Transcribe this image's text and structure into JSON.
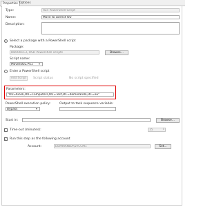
{
  "tabs": {
    "properties": "Properties",
    "options": "Options"
  },
  "type": {
    "label": "Type:",
    "value": "Run PowerShell Script"
  },
  "name": {
    "label": "Name:",
    "value": "Move to correct OU"
  },
  "description": {
    "label": "Description:",
    "value": ""
  },
  "package_option": {
    "label": "Select a package with a PowerShell script"
  },
  "package": {
    "label": "Package:",
    "value": "DB0001C3, OSD Powershell scripts",
    "browse": "Browse..."
  },
  "script_name": {
    "label": "Script name:",
    "value": "MoveToOu.PS1"
  },
  "enter_option": {
    "label": "Enter a PowerShell script"
  },
  "script_buttons": {
    "add": "Add Script",
    "status": "Script status",
    "none": "No script specified"
  },
  "parameters": {
    "label": "Parameters:",
    "value": "\"OU=Kiosk,OU=Computers,OU=Test,DC=demoranda,DC=eu\""
  },
  "execution_policy": {
    "label": "PowerShell execution policy:",
    "value": "Bypass"
  },
  "output_variable": {
    "label": "Output to task sequence variable:",
    "value": ""
  },
  "start_in": {
    "label": "Start in:",
    "value": "",
    "browse": "Browse..."
  },
  "timeout": {
    "label": "Time-out (minutes):",
    "value": "15"
  },
  "run_as": {
    "label": "Run this step as the following account",
    "account_label": "Account:",
    "account_value": "DEMIRANDA\\SVCCM1",
    "set": "Set..."
  },
  "colors": {
    "highlight": "#e00000",
    "border": "#a9a9a9"
  }
}
